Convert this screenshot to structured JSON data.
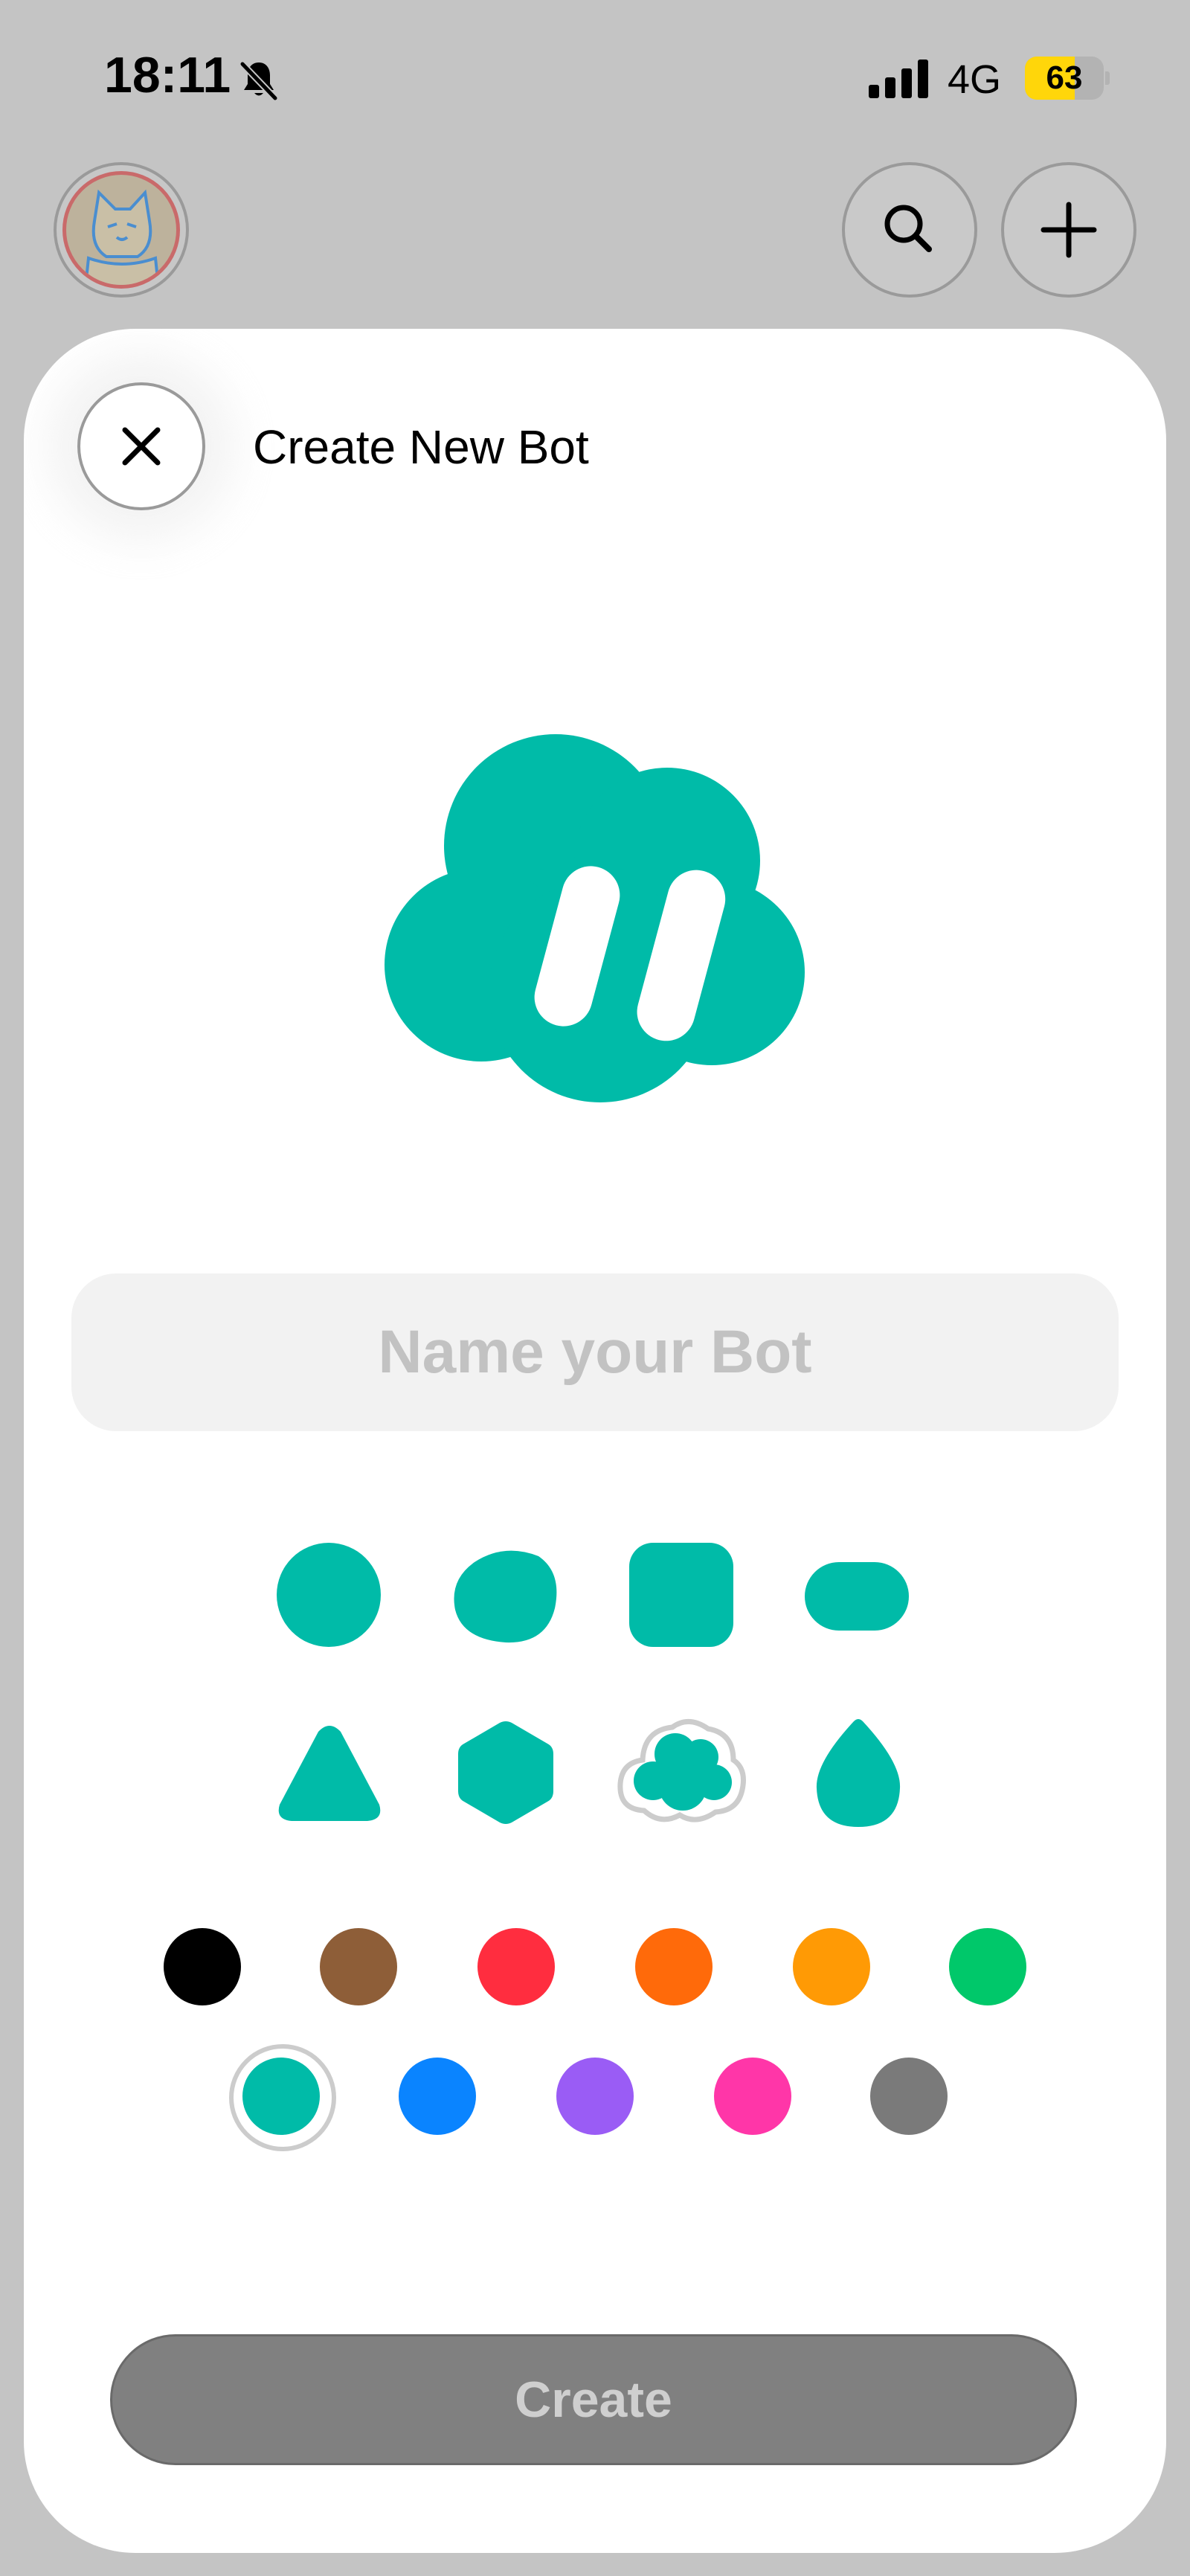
{
  "status_bar": {
    "time": "18:11",
    "network": "4G",
    "battery_level": "63"
  },
  "sheet": {
    "title": "Create New Bot",
    "name_input": {
      "placeholder": "Name your Bot",
      "value": ""
    },
    "create_label": "Create"
  },
  "shapes": [
    "circle",
    "blob",
    "rounded-square",
    "pill",
    "triangle",
    "hexagon",
    "cloud",
    "drop"
  ],
  "selected_shape": "cloud",
  "colors": [
    "#000000",
    "#8e5e38",
    "#ff2d3f",
    "#ff6a0a",
    "#ff9a05",
    "#00c86a",
    "#00bba8",
    "#0a84ff",
    "#9a5cf5",
    "#ff36a8",
    "#7a7a7a"
  ],
  "selected_color": "#00bba8"
}
